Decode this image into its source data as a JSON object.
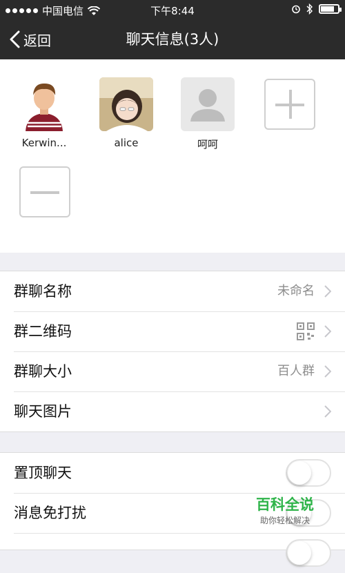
{
  "status_bar": {
    "carrier": "中国电信",
    "time": "下午8:44",
    "battery_level_percent": 80
  },
  "nav": {
    "back_label": "返回",
    "title": "聊天信息(3人)"
  },
  "members": [
    {
      "name": "Kerwin..."
    },
    {
      "name": "alice"
    },
    {
      "name": "呵呵"
    }
  ],
  "settings_group_1": {
    "rows": [
      {
        "label": "群聊名称",
        "value": "未命名"
      },
      {
        "label": "群二维码",
        "value": ""
      },
      {
        "label": "群聊大小",
        "value": "百人群"
      },
      {
        "label": "聊天图片",
        "value": ""
      }
    ]
  },
  "settings_group_2": {
    "rows": [
      {
        "label": "置顶聊天",
        "toggle_on": false
      },
      {
        "label": "消息免打扰",
        "toggle_on": false
      }
    ]
  },
  "watermark": {
    "main": "百科全说",
    "sub": "助你轻松解决"
  },
  "colors": {
    "nav_bg": "#2b2b2b",
    "page_bg": "#efeff4",
    "watermark_green": "#2fb44a"
  }
}
